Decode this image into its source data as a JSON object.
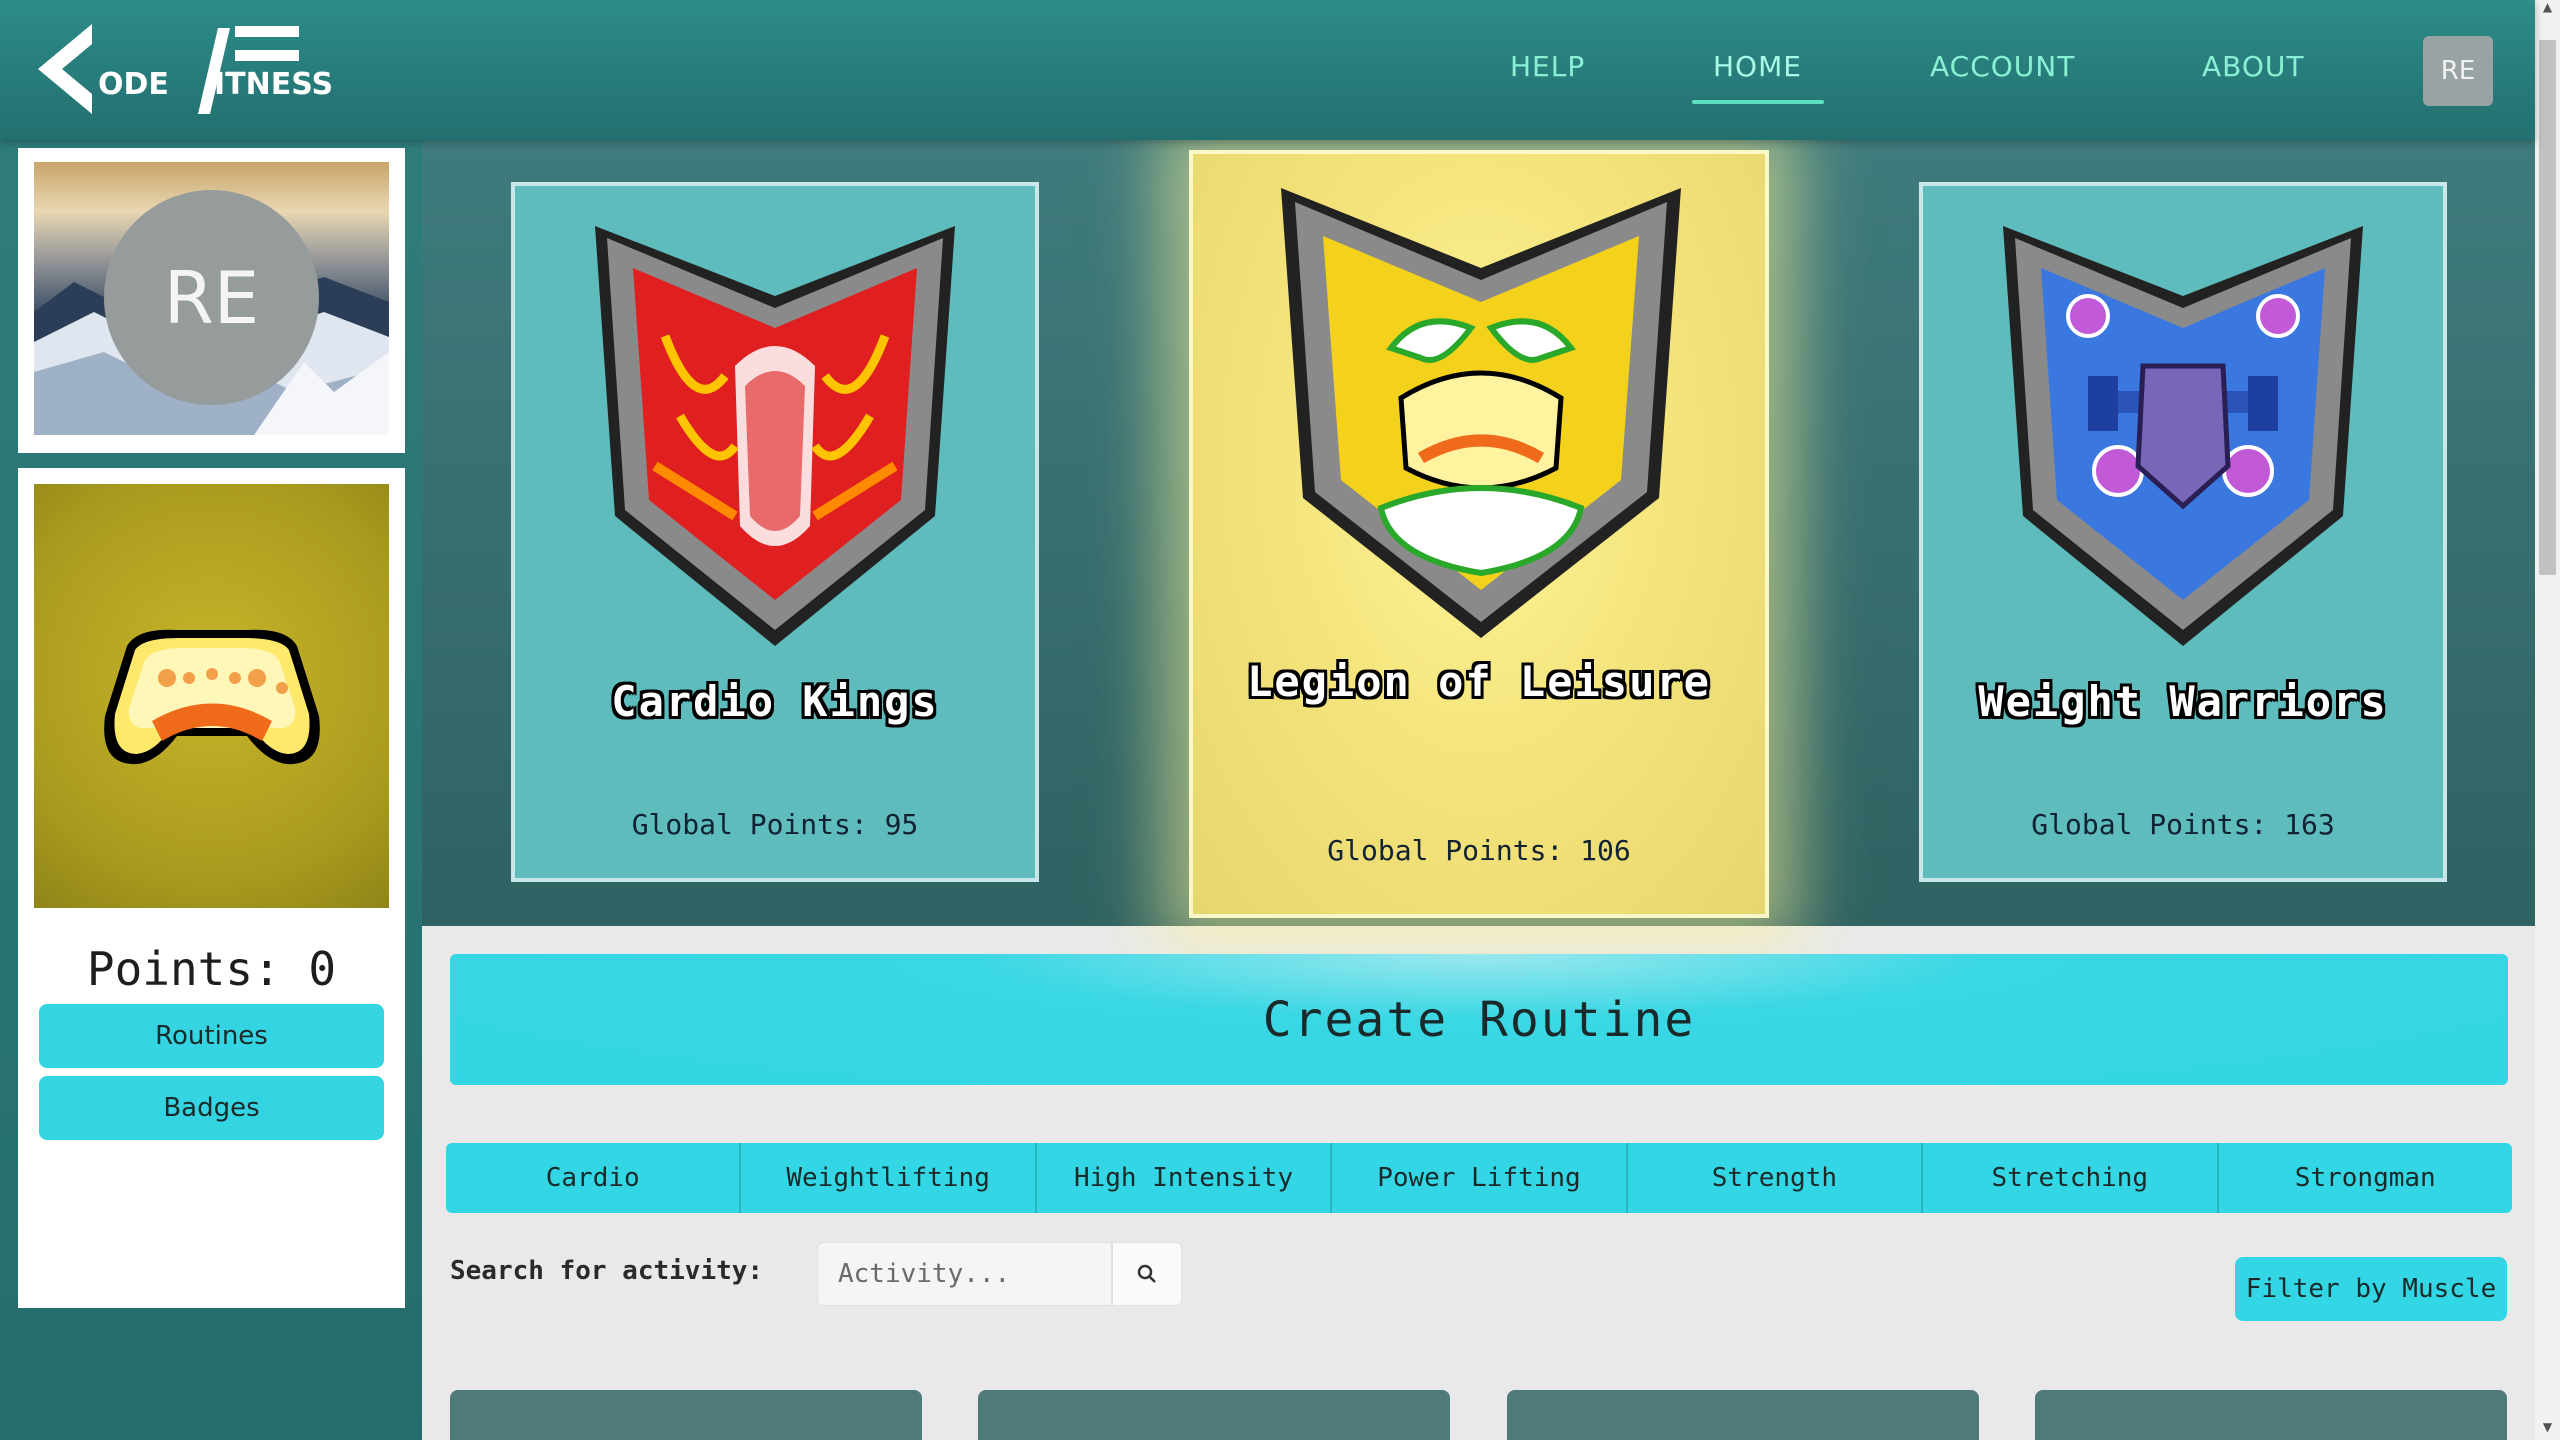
{
  "brand": {
    "logo_text": "Kode Fitness"
  },
  "nav": {
    "help": "HELP",
    "home": "HOME",
    "account": "ACCOUNT",
    "about": "ABOUT",
    "avatar_initials": "RE",
    "active": "home"
  },
  "sidebar": {
    "profile_initials": "RE",
    "points_label": "Points: 0",
    "routines_button": "Routines",
    "badges_button": "Badges"
  },
  "teams": [
    {
      "name": "Cardio Kings",
      "points_label": "Global Points: 95",
      "shield_color": "#e02020",
      "selected": false
    },
    {
      "name": "Legion of Leisure",
      "points_label": "Global Points: 106",
      "shield_color": "#f4d21c",
      "selected": true
    },
    {
      "name": "Weight Warriors",
      "points_label": "Global Points: 163",
      "shield_color": "#3a78e0",
      "selected": false
    }
  ],
  "main": {
    "create_routine": "Create Routine",
    "filters": [
      "Cardio",
      "Weightlifting",
      "High Intensity",
      "Power Lifting",
      "Strength",
      "Stretching",
      "Strongman"
    ],
    "search_label": "Search for activity:",
    "search_placeholder": "Activity...",
    "filter_muscle": "Filter by Muscle"
  },
  "colors": {
    "nav_bg": "#2b8483",
    "accent_cyan": "#33d6e4",
    "nav_text": "#8af0d4"
  }
}
